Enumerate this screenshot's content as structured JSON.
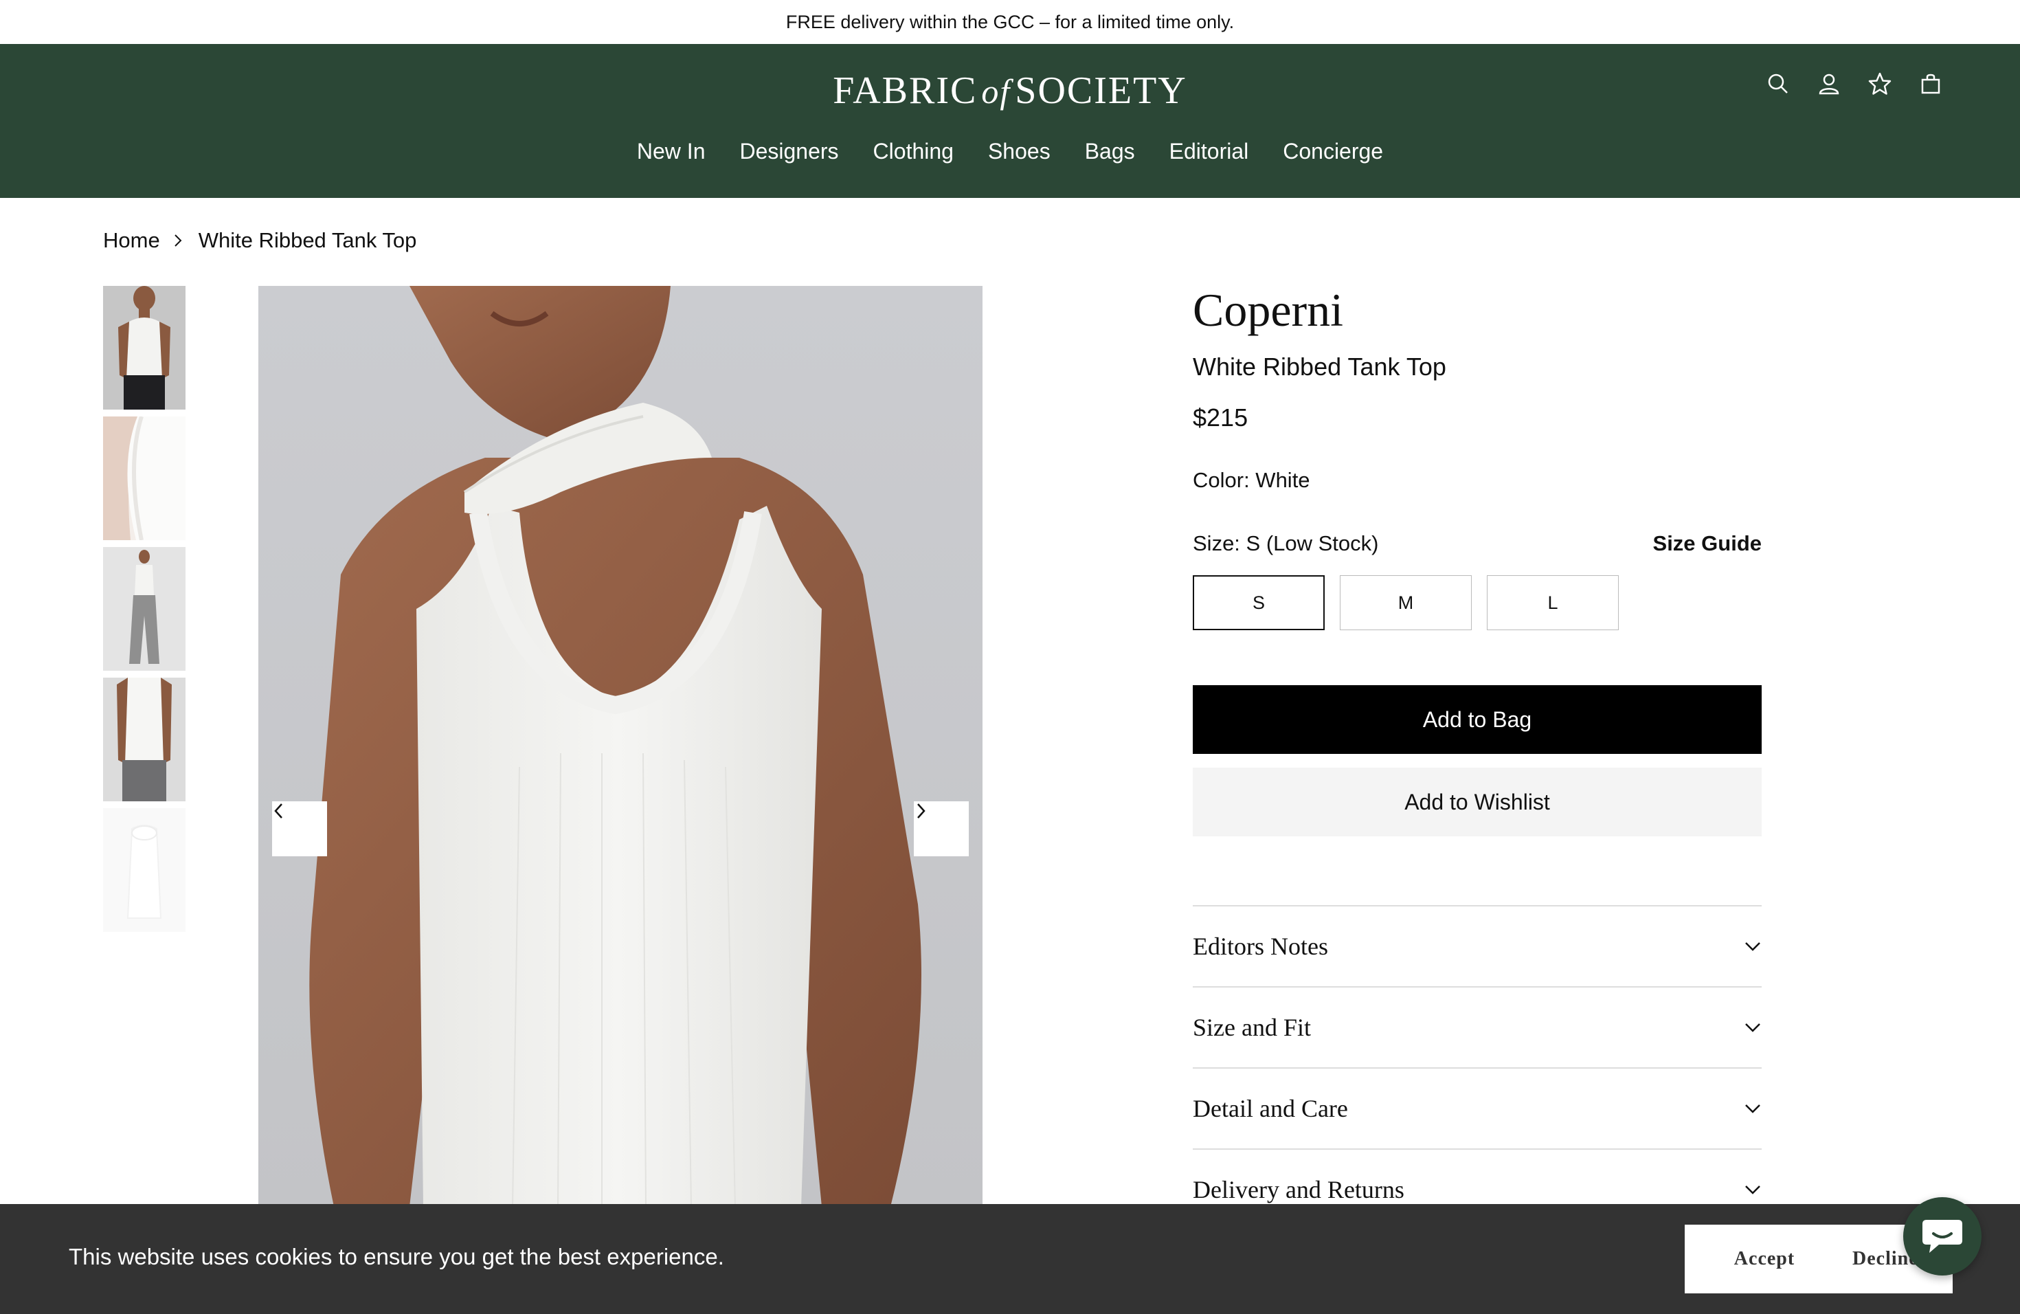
{
  "announcement": "FREE delivery within the GCC – for a limited time only.",
  "header": {
    "logo_part1": "FABRIC",
    "logo_of": "of",
    "logo_part2": "SOCIETY",
    "nav": [
      "New In",
      "Designers",
      "Clothing",
      "Shoes",
      "Bags",
      "Editorial",
      "Concierge"
    ],
    "icons": [
      "search-icon",
      "account-icon",
      "wishlist-star-icon",
      "bag-icon"
    ]
  },
  "breadcrumb": {
    "home": "Home",
    "current": "White Ribbed Tank Top"
  },
  "gallery": {
    "thumbnail_count": 5
  },
  "product": {
    "brand": "Coperni",
    "name": "White Ribbed Tank Top",
    "price": "$215",
    "color_label": "Color: White",
    "size_label": "Size: S (Low Stock)",
    "size_guide": "Size Guide",
    "sizes": [
      "S",
      "M",
      "L"
    ],
    "selected_size": "S",
    "add_to_bag": "Add to Bag",
    "add_to_wishlist": "Add to Wishlist"
  },
  "accordion": [
    "Editors Notes",
    "Size and Fit",
    "Detail and Care",
    "Delivery and Returns"
  ],
  "cookie": {
    "message": "This website uses cookies to ensure you get the best experience.",
    "accept": "Accept",
    "decline": "Decline"
  },
  "colors": {
    "header_bg": "#2b4736",
    "cookie_bg": "#333333",
    "primary_button": "#000000"
  }
}
